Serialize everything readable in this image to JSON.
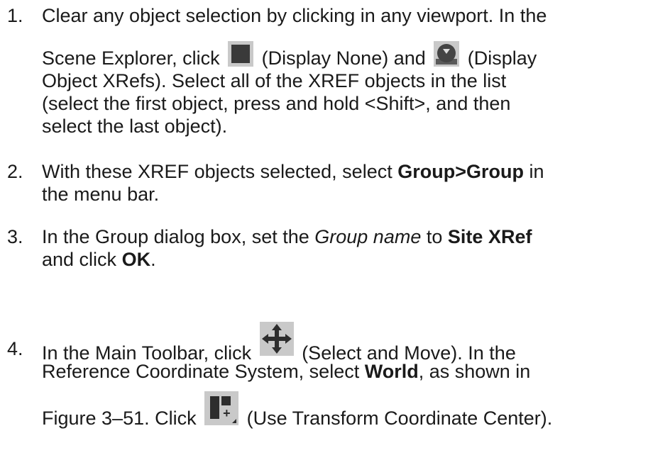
{
  "steps": [
    {
      "number": "1.",
      "lines": {
        "l1": "Clear any object selection by clicking in any viewport. In the",
        "l2a": "Scene Explorer, click",
        "l2b": "(Display None) and",
        "l2c": "(Display",
        "l3": "Object XRefs). Select all of the XREF objects in the list",
        "l4": "(select the first object, press and hold <Shift>, and then",
        "l5": "select the last object)."
      }
    },
    {
      "number": "2.",
      "lines": {
        "l1a": "With these XREF objects selected, select",
        "l1b": "Group>Group",
        "l1c": "in",
        "l2": "the menu bar."
      }
    },
    {
      "number": "3.",
      "lines": {
        "l1a": "In the Group dialog box, set the",
        "l1b": "Group name",
        "l1c": "to",
        "l1d": "Site XRef",
        "l2a": "and click",
        "l2b": "OK",
        "l2c": "."
      }
    },
    {
      "number": "4.",
      "lines": {
        "l1a": "In the Main Toolbar, click",
        "l1b": "(Select and Move). In the",
        "l2a": "Reference Coordinate System, select",
        "l2b": "World",
        "l2c": ", as shown in",
        "l3a": "Figure 3–51. Click",
        "l3b": "(Use Transform Coordinate Center)."
      }
    }
  ],
  "icons": {
    "display_none": "display-none-icon",
    "display_object_xrefs": "display-object-xrefs-icon",
    "select_and_move": "select-and-move-icon",
    "use_transform_coordinate_center": "use-transform-coordinate-center-icon"
  },
  "colors": {
    "text": "#1a1a1a",
    "icon_bg": "#c9c9c9",
    "icon_fg": "#2d2d2d"
  }
}
